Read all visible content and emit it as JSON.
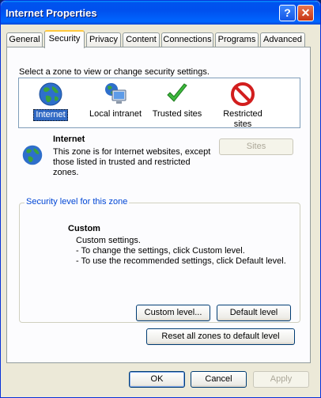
{
  "window": {
    "title": "Internet Properties"
  },
  "tabs": [
    "General",
    "Security",
    "Privacy",
    "Content",
    "Connections",
    "Programs",
    "Advanced"
  ],
  "security": {
    "instruction": "Select a zone to view or change security settings.",
    "zones": [
      {
        "label": "Internet",
        "icon": "globe-icon",
        "selected": true
      },
      {
        "label": "Local intranet",
        "icon": "monitor-globe-icon",
        "selected": false
      },
      {
        "label": "Trusted sites",
        "icon": "green-check-icon",
        "selected": false
      },
      {
        "label": "Restricted sites",
        "icon": "red-no-icon",
        "selected": false
      }
    ],
    "zone_info": {
      "title": "Internet",
      "description": "This zone is for Internet websites, except those listed in trusted and restricted zones."
    },
    "sites_button": "Sites",
    "level_group_title": "Security level for this zone",
    "level": {
      "title": "Custom",
      "lines": [
        "Custom settings.",
        "- To change the settings, click Custom level.",
        "- To use the recommended settings, click Default level."
      ]
    },
    "custom_level_button": "Custom level...",
    "default_level_button": "Default level",
    "reset_all_button": "Reset all zones to default level"
  },
  "footer": {
    "ok": "OK",
    "cancel": "Cancel",
    "apply": "Apply"
  },
  "colors": {
    "title_bar": "#0053EE",
    "selection": "#316AC5",
    "dialog": "#ECE9D8"
  }
}
